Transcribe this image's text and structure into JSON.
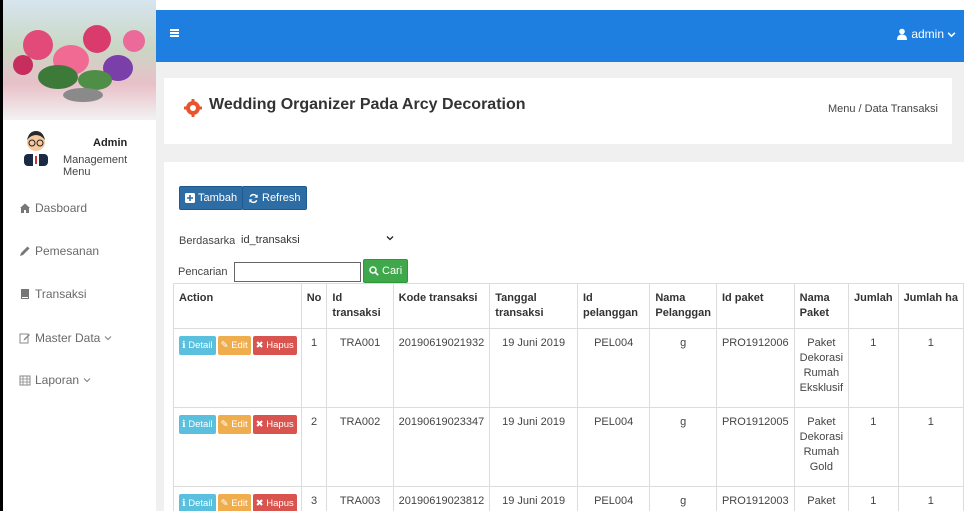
{
  "sidebar": {
    "admin_name": "Admin",
    "admin_role": "Management Menu",
    "items": [
      {
        "label": "Dasboard",
        "icon": "home-icon"
      },
      {
        "label": "Pemesanan",
        "icon": "pencil-icon"
      },
      {
        "label": "Transaksi",
        "icon": "book-icon"
      },
      {
        "label": "Master Data",
        "icon": "edit-icon"
      },
      {
        "label": "Laporan",
        "icon": "calendar-icon"
      }
    ]
  },
  "topbar": {
    "user": "admin",
    "accent": "#1f7fe0"
  },
  "header": {
    "title": "Wedding Organizer Pada Arcy Decoration",
    "breadcrumb": "Menu / Data Transaksi"
  },
  "toolbar": {
    "tambah_label": "Tambah",
    "refresh_label": "Refresh",
    "filter_label": "Berdasarkan:",
    "filter_value": "id_transaksi",
    "search_label": "Pencarian",
    "cari_label": "Cari"
  },
  "table": {
    "columns": [
      "Action",
      "No",
      "Id transaksi",
      "Kode transaksi",
      "Tanggal transaksi",
      "Id pelanggan",
      "Nama Pelanggan",
      "Id paket",
      "Nama Paket",
      "Jumlah",
      "Jumlah ha"
    ],
    "action_labels": {
      "detail": "Detail",
      "edit": "Edit",
      "hapus": "Hapus"
    },
    "rows": [
      {
        "no": "1",
        "id_transaksi": "TRA001",
        "kode": "20190619021932",
        "tanggal": "19 Juni 2019",
        "id_pelanggan": "PEL004",
        "nama_pelanggan": "g",
        "id_paket": "PRO1912006",
        "nama_paket": "Paket Dekorasi Rumah Eksklusif",
        "jumlah": "1",
        "jumlah_hari": "1"
      },
      {
        "no": "2",
        "id_transaksi": "TRA002",
        "kode": "20190619023347",
        "tanggal": "19 Juni 2019",
        "id_pelanggan": "PEL004",
        "nama_pelanggan": "g",
        "id_paket": "PRO1912005",
        "nama_paket": "Paket Dekorasi Rumah Gold",
        "jumlah": "1",
        "jumlah_hari": "1"
      },
      {
        "no": "3",
        "id_transaksi": "TRA003",
        "kode": "20190619023812",
        "tanggal": "19 Juni 2019",
        "id_pelanggan": "PEL004",
        "nama_pelanggan": "g",
        "id_paket": "PRO1912003",
        "nama_paket": "Paket",
        "jumlah": "1",
        "jumlah_hari": "1"
      }
    ]
  }
}
